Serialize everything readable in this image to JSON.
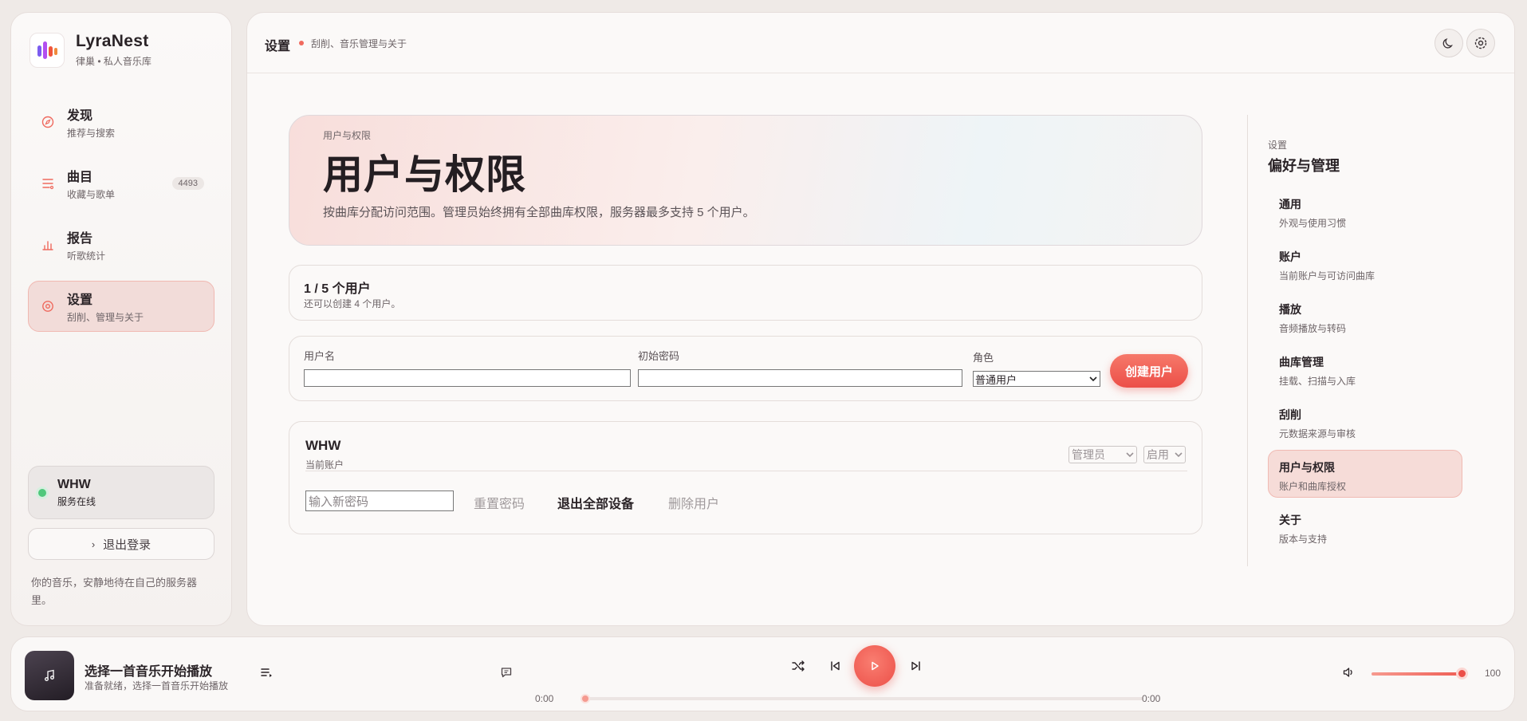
{
  "brand": {
    "name": "LyraNest",
    "subtitle": "律巢 • 私人音乐库"
  },
  "nav": {
    "items": [
      {
        "title": "发现",
        "subtitle": "推荐与搜索",
        "icon": "compass-icon"
      },
      {
        "title": "曲目",
        "subtitle": "收藏与歌单",
        "icon": "list-icon",
        "badge": "4493"
      },
      {
        "title": "报告",
        "subtitle": "听歌统计",
        "icon": "bar-chart-icon"
      },
      {
        "title": "设置",
        "subtitle": "刮削、管理与关于",
        "icon": "gear-icon",
        "active": true
      }
    ]
  },
  "status": {
    "name": "WHW",
    "text": "服务在线"
  },
  "logout_label": "退出登录",
  "sidebar_footer": "你的音乐，安静地待在自己的服务器里。",
  "topbar": {
    "title": "设置",
    "subtitle": "刮削、音乐管理与关于"
  },
  "hero": {
    "kicker": "用户与权限",
    "title": "用户与权限",
    "description": "按曲库分配访问范围。管理员始终拥有全部曲库权限，服务器最多支持 5 个用户。"
  },
  "user_count": {
    "title": "1 / 5 个用户",
    "subtitle": "还可以创建 4 个用户。"
  },
  "create_form": {
    "username_label": "用户名",
    "username_value": "",
    "password_label": "初始密码",
    "password_value": "",
    "role_label": "角色",
    "role_value": "普通用户",
    "create_button": "创建用户"
  },
  "user_entry": {
    "name": "WHW",
    "subtitle": "当前账户",
    "role_value": "管理员",
    "state_value": "启用",
    "new_password_placeholder": "输入新密码",
    "reset_password": "重置密码",
    "logout_all": "退出全部设备",
    "delete_user": "删除用户"
  },
  "settings_nav": {
    "kicker": "设置",
    "title": "偏好与管理",
    "items": [
      {
        "label": "通用",
        "subtitle": "外观与使用习惯"
      },
      {
        "label": "账户",
        "subtitle": "当前账户与可访问曲库"
      },
      {
        "label": "播放",
        "subtitle": "音频播放与转码"
      },
      {
        "label": "曲库管理",
        "subtitle": "挂载、扫描与入库"
      },
      {
        "label": "刮削",
        "subtitle": "元数据来源与审核"
      },
      {
        "label": "用户与权限",
        "subtitle": "账户和曲库授权",
        "active": true
      },
      {
        "label": "关于",
        "subtitle": "版本与支持"
      }
    ]
  },
  "player": {
    "title": "选择一首音乐开始播放",
    "subtitle": "准备就绪，选择一首音乐开始播放",
    "current_time": "0:00",
    "total_time": "0:00",
    "progress": 0,
    "volume": 100
  },
  "colors": {
    "accent": "#ec4f48",
    "accent_soft": "#f2dcd9",
    "online": "#4fc87b"
  }
}
